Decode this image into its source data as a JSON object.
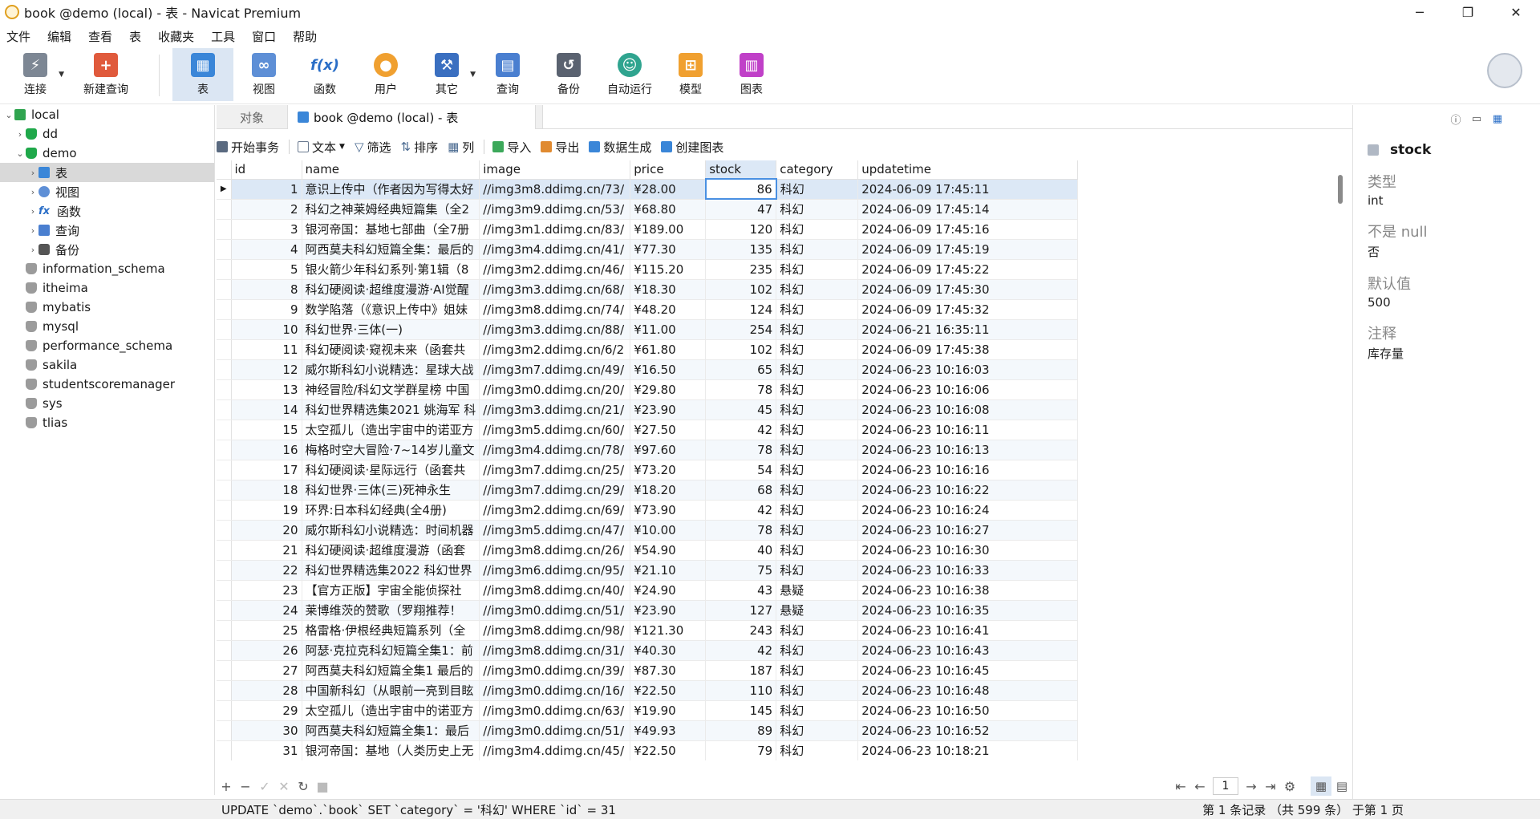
{
  "window": {
    "title": "book @demo (local) - 表 - Navicat Premium",
    "minimize": "─",
    "restore": "❐",
    "close": "✕"
  },
  "menu": [
    "文件",
    "编辑",
    "查看",
    "表",
    "收藏夹",
    "工具",
    "窗口",
    "帮助"
  ],
  "toolbar": {
    "connect": "连接",
    "new_query": "新建查询",
    "table": "表",
    "view": "视图",
    "function": "函数",
    "user": "用户",
    "other": "其它",
    "query": "查询",
    "backup": "备份",
    "automation": "自动运行",
    "model": "模型",
    "chart": "图表"
  },
  "tree": {
    "connection": "local",
    "dd": "dd",
    "demo": "demo",
    "demo_children": {
      "tables": "表",
      "views": "视图",
      "functions": "函数",
      "queries": "查询",
      "backups": "备份"
    },
    "databases": [
      "information_schema",
      "itheima",
      "mybatis",
      "mysql",
      "performance_schema",
      "sakila",
      "studentscoremanager",
      "sys",
      "tlias"
    ]
  },
  "tabs": {
    "objects": "对象",
    "active": "book @demo (local) - 表"
  },
  "grid_toolbar": {
    "begin_tx": "开始事务",
    "text": "文本",
    "filter": "筛选",
    "sort": "排序",
    "columns": "列",
    "import": "导入",
    "export": "导出",
    "data_gen": "数据生成",
    "create_chart": "创建图表"
  },
  "columns": [
    "id",
    "name",
    "image",
    "price",
    "stock",
    "category",
    "updatetime"
  ],
  "rows": [
    [
      "1",
      "意识上传中（作者因为写得太好",
      "//img3m8.ddimg.cn/73/",
      "¥28.00",
      "86",
      "科幻",
      "2024-06-09 17:45:11"
    ],
    [
      "2",
      "科幻之神莱姆经典短篇集（全2",
      "//img3m9.ddimg.cn/53/",
      "¥68.80",
      "47",
      "科幻",
      "2024-06-09 17:45:14"
    ],
    [
      "3",
      "银河帝国：基地七部曲（全7册",
      "//img3m1.ddimg.cn/83/",
      "¥189.00",
      "120",
      "科幻",
      "2024-06-09 17:45:16"
    ],
    [
      "4",
      "阿西莫夫科幻短篇全集：最后的",
      "//img3m4.ddimg.cn/41/",
      "¥77.30",
      "135",
      "科幻",
      "2024-06-09 17:45:19"
    ],
    [
      "5",
      "银火箭少年科幻系列·第1辑（8",
      "//img3m2.ddimg.cn/46/",
      "¥115.20",
      "235",
      "科幻",
      "2024-06-09 17:45:22"
    ],
    [
      "8",
      "科幻硬阅读·超维度漫游·AI觉醒",
      "//img3m3.ddimg.cn/68/",
      "¥18.30",
      "102",
      "科幻",
      "2024-06-09 17:45:30"
    ],
    [
      "9",
      "数学陷落（《意识上传中》姐妹",
      "//img3m8.ddimg.cn/74/",
      "¥48.20",
      "124",
      "科幻",
      "2024-06-09 17:45:32"
    ],
    [
      "10",
      "科幻世界·三体(一)",
      "//img3m3.ddimg.cn/88/",
      "¥11.00",
      "254",
      "科幻",
      "2024-06-21 16:35:11"
    ],
    [
      "11",
      "科幻硬阅读·窥视未来（函套共",
      "//img3m2.ddimg.cn/6/2",
      "¥61.80",
      "102",
      "科幻",
      "2024-06-09 17:45:38"
    ],
    [
      "12",
      "威尔斯科幻小说精选：星球大战",
      "//img3m7.ddimg.cn/49/",
      "¥16.50",
      "65",
      "科幻",
      "2024-06-23 10:16:03"
    ],
    [
      "13",
      "神经冒险/科幻文学群星榜 中国",
      "//img3m0.ddimg.cn/20/",
      "¥29.80",
      "78",
      "科幻",
      "2024-06-23 10:16:06"
    ],
    [
      "14",
      "科幻世界精选集2021 姚海军 科",
      "//img3m3.ddimg.cn/21/",
      "¥23.90",
      "45",
      "科幻",
      "2024-06-23 10:16:08"
    ],
    [
      "15",
      "太空孤儿（造出宇宙中的诺亚方",
      "//img3m5.ddimg.cn/60/",
      "¥27.50",
      "42",
      "科幻",
      "2024-06-23 10:16:11"
    ],
    [
      "16",
      "梅格时空大冒险·7~14岁儿童文",
      "//img3m4.ddimg.cn/78/",
      "¥97.60",
      "78",
      "科幻",
      "2024-06-23 10:16:13"
    ],
    [
      "17",
      "科幻硬阅读·星际远行（函套共",
      "//img3m7.ddimg.cn/25/",
      "¥73.20",
      "54",
      "科幻",
      "2024-06-23 10:16:16"
    ],
    [
      "18",
      "科幻世界·三体(三)死神永生",
      "//img3m7.ddimg.cn/29/",
      "¥18.20",
      "68",
      "科幻",
      "2024-06-23 10:16:22"
    ],
    [
      "19",
      "环界:日本科幻经典(全4册)",
      "//img3m2.ddimg.cn/69/",
      "¥73.90",
      "42",
      "科幻",
      "2024-06-23 10:16:24"
    ],
    [
      "20",
      "威尔斯科幻小说精选：时间机器",
      "//img3m5.ddimg.cn/47/",
      "¥10.00",
      "78",
      "科幻",
      "2024-06-23 10:16:27"
    ],
    [
      "21",
      "科幻硬阅读·超维度漫游（函套",
      "//img3m8.ddimg.cn/26/",
      "¥54.90",
      "40",
      "科幻",
      "2024-06-23 10:16:30"
    ],
    [
      "22",
      "科幻世界精选集2022 科幻世界",
      "//img3m6.ddimg.cn/95/",
      "¥21.10",
      "75",
      "科幻",
      "2024-06-23 10:16:33"
    ],
    [
      "23",
      "【官方正版】宇宙全能侦探社",
      "//img3m8.ddimg.cn/40/",
      "¥24.90",
      "43",
      "悬疑",
      "2024-06-23 10:16:38"
    ],
    [
      "24",
      "莱博维茨的赞歌（罗翔推荐！",
      "//img3m0.ddimg.cn/51/",
      "¥23.90",
      "127",
      "悬疑",
      "2024-06-23 10:16:35"
    ],
    [
      "25",
      "格雷格·伊根经典短篇系列（全",
      "//img3m8.ddimg.cn/98/",
      "¥121.30",
      "243",
      "科幻",
      "2024-06-23 10:16:41"
    ],
    [
      "26",
      "阿瑟·克拉克科幻短篇全集1：前",
      "//img3m8.ddimg.cn/31/",
      "¥40.30",
      "42",
      "科幻",
      "2024-06-23 10:16:43"
    ],
    [
      "27",
      "阿西莫夫科幻短篇全集1 最后的",
      "//img3m0.ddimg.cn/39/",
      "¥87.30",
      "187",
      "科幻",
      "2024-06-23 10:16:45"
    ],
    [
      "28",
      "中国新科幻（从眼前一亮到目眩",
      "//img3m0.ddimg.cn/16/",
      "¥22.50",
      "110",
      "科幻",
      "2024-06-23 10:16:48"
    ],
    [
      "29",
      "太空孤儿（造出宇宙中的诺亚方",
      "//img3m0.ddimg.cn/63/",
      "¥19.90",
      "145",
      "科幻",
      "2024-06-23 10:16:50"
    ],
    [
      "30",
      "阿西莫夫科幻短篇全集1：最后",
      "//img3m0.ddimg.cn/51/",
      "¥49.93",
      "89",
      "科幻",
      "2024-06-23 10:16:52"
    ],
    [
      "31",
      "银河帝国：基地（人类历史上无",
      "//img3m4.ddimg.cn/45/",
      "¥22.50",
      "79",
      "科幻",
      "2024-06-23 10:18:21"
    ]
  ],
  "pager": {
    "page": "1"
  },
  "status": {
    "sql": "UPDATE `demo`.`book` SET `category` = '科幻' WHERE `id` = 31",
    "records": "第 1 条记录 （共 599 条） 于第 1 页"
  },
  "field_panel": {
    "name": "stock",
    "type_label": "类型",
    "type_value": "int",
    "notnull_label": "不是 null",
    "notnull_value": "否",
    "default_label": "默认值",
    "default_value": "500",
    "comment_label": "注释",
    "comment_value": "库存量"
  }
}
